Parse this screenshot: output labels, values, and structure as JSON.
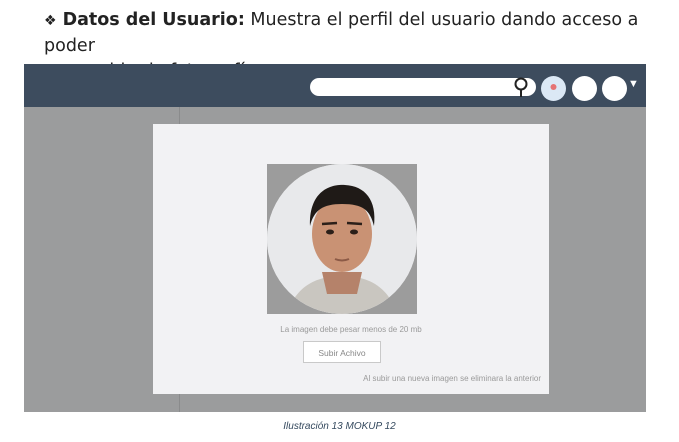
{
  "paragraph": {
    "bullet": "❖",
    "bold_label": "Datos del Usuario:",
    "text_line1": " Muestra el perfil del usuario dando acceso a poder",
    "text_line2": "cambiar la fotografía."
  },
  "mockup": {
    "header": {
      "search_placeholder": ""
    },
    "profile_card": {
      "photo_alt": "Foto de perfil del usuario",
      "size_hint": "La imagen debe pesar menos de 20 mb",
      "upload_button_label": "Subir Achivo",
      "replace_note": "Al subir una nueva imagen se eliminara la anterior"
    }
  },
  "caption": "Ilustración 13 MOKUP 12",
  "colors": {
    "topbar": "#3d4c5e",
    "backdrop": "#9b9c9d",
    "card": "#f2f2f4",
    "caption": "#34495e"
  },
  "icons": [
    "search-icon",
    "notification-avatar-icon",
    "user-avatar-icon",
    "menu-avatar-icon",
    "caret-down-icon"
  ]
}
